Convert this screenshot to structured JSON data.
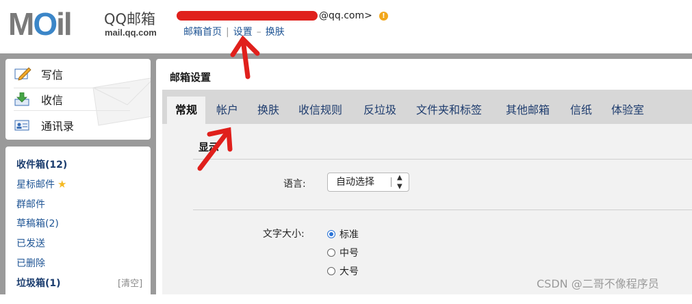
{
  "header": {
    "logo_text": "MAIL",
    "brand": "QQ邮箱",
    "brand_domain": "mail.qq.com",
    "account_suffix": "@qq.com>",
    "links": {
      "home": "邮箱首页",
      "settings": "设置",
      "skin": "换肤"
    },
    "separator_pipe": "|",
    "separator_dash": "–",
    "warning_glyph": "!"
  },
  "sidebar": {
    "actions": {
      "compose": "写信",
      "receive": "收信",
      "contacts": "通讯录"
    },
    "folders": {
      "inbox": "收件箱(12)",
      "starred": "星标邮件",
      "star_glyph": "★",
      "group": "群邮件",
      "drafts": "草稿箱(2)",
      "sent": "已发送",
      "deleted": "已删除",
      "spam": "垃圾箱(1)",
      "clear": "[清空]"
    }
  },
  "main": {
    "title": "邮箱设置",
    "tabs": [
      "常规",
      "帐户",
      "换肤",
      "收信规则",
      "反垃圾",
      "文件夹和标签",
      "其他邮箱",
      "信纸",
      "体验室"
    ],
    "section_title": "显示",
    "language_label": "语言:",
    "language_value": "自动选择",
    "fontsize_label": "文字大小:",
    "fontsize_options": [
      "标准",
      "中号",
      "大号"
    ],
    "fontsize_selected": "标准"
  },
  "watermark": "CSDN @二哥不像程序员",
  "colors": {
    "link_blue": "#1e5494",
    "annotation_red": "#e0201c",
    "frame_gray": "#9a9a9a",
    "tabbar_gray": "#d7d7d7",
    "content_bg": "#f2f2f2"
  }
}
